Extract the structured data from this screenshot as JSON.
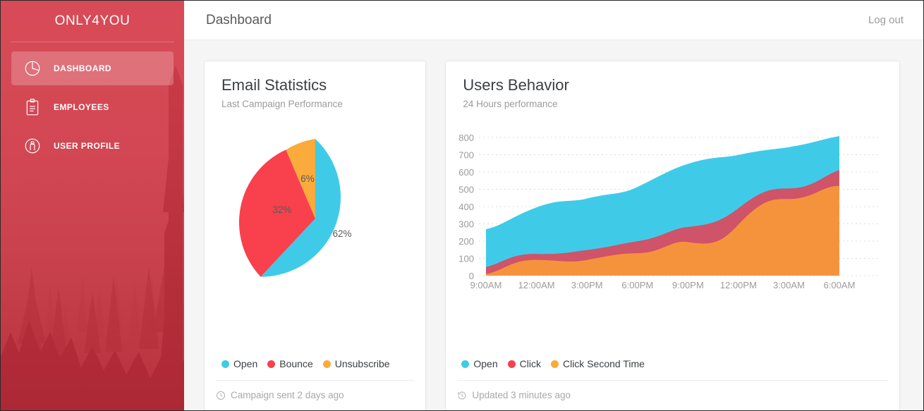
{
  "sidebar": {
    "brand": "ONLY4YOU",
    "items": [
      {
        "label": "DASHBOARD",
        "icon": "pie-chart-icon",
        "active": true
      },
      {
        "label": "EMPLOYEES",
        "icon": "clipboard-icon",
        "active": false
      },
      {
        "label": "USER PROFILE",
        "icon": "person-icon",
        "active": false
      }
    ]
  },
  "topbar": {
    "title": "Dashboard",
    "logout_label": "Log out"
  },
  "colors": {
    "sidebar_red": "#d8404e",
    "open_blue": "#3fcbe8",
    "bounce_red": "#f9404d",
    "unsubscribe_orange": "#fbaa3c",
    "click_pink": "#cf5369",
    "click2_orange": "#f5933d",
    "text_dark": "#3c4043",
    "text_muted": "#9b9b9b"
  },
  "cards": {
    "email": {
      "title": "Email Statistics",
      "subtitle": "Last Campaign Performance",
      "footer_icon": "clock-icon",
      "footer_text": "Campaign sent 2 days ago",
      "legend": [
        {
          "label": "Open",
          "color": "#3fcbe8"
        },
        {
          "label": "Bounce",
          "color": "#f9404d"
        },
        {
          "label": "Unsubscribe",
          "color": "#fbaa3c"
        }
      ]
    },
    "users": {
      "title": "Users Behavior",
      "subtitle": "24 Hours performance",
      "footer_icon": "history-icon",
      "footer_text": "Updated 3 minutes ago",
      "legend": [
        {
          "label": "Open",
          "color": "#3fcbe8"
        },
        {
          "label": "Click",
          "color": "#f9404d"
        },
        {
          "label": "Click Second Time",
          "color": "#fbaa3c"
        }
      ]
    }
  },
  "chart_data": [
    {
      "type": "pie",
      "title": "Email Statistics",
      "subtitle": "Last Campaign Performance",
      "legend_position": "bottom",
      "labels": [
        "Open",
        "Bounce",
        "Unsubscribe"
      ],
      "values": [
        62,
        32,
        6
      ],
      "value_labels": [
        "62%",
        "32%",
        "6%"
      ],
      "colors": [
        "#3fcbe8",
        "#f9404d",
        "#fbaa3c"
      ],
      "start_angle_deg": -90
    },
    {
      "type": "area",
      "title": "Users Behavior",
      "subtitle": "24 Hours performance",
      "stacked": true,
      "grid": true,
      "legend_position": "bottom",
      "xlabel": "",
      "ylabel": "",
      "ylim": [
        0,
        800
      ],
      "yticks": [
        0,
        100,
        200,
        300,
        400,
        500,
        600,
        700,
        800
      ],
      "x": [
        "9:00AM",
        "12:00AM",
        "3:00PM",
        "6:00PM",
        "9:00PM",
        "12:00PM",
        "3:00AM",
        "6:00AM"
      ],
      "x_positions": [
        0,
        1,
        2,
        3,
        4,
        5,
        6,
        7
      ],
      "series": [
        {
          "name": "Click Second Time",
          "color": "#f5933d",
          "values": [
            10,
            95,
            70,
            130,
            210,
            300,
            370,
            520
          ]
        },
        {
          "name": "Click",
          "color": "#cf5369",
          "values": [
            40,
            35,
            40,
            55,
            65,
            90,
            70,
            95
          ]
        },
        {
          "name": "Open",
          "color": "#3fcbe8",
          "values": [
            215,
            265,
            320,
            300,
            320,
            260,
            235,
            210
          ]
        }
      ],
      "totals": [
        265,
        395,
        430,
        485,
        595,
        650,
        675,
        825
      ]
    }
  ]
}
